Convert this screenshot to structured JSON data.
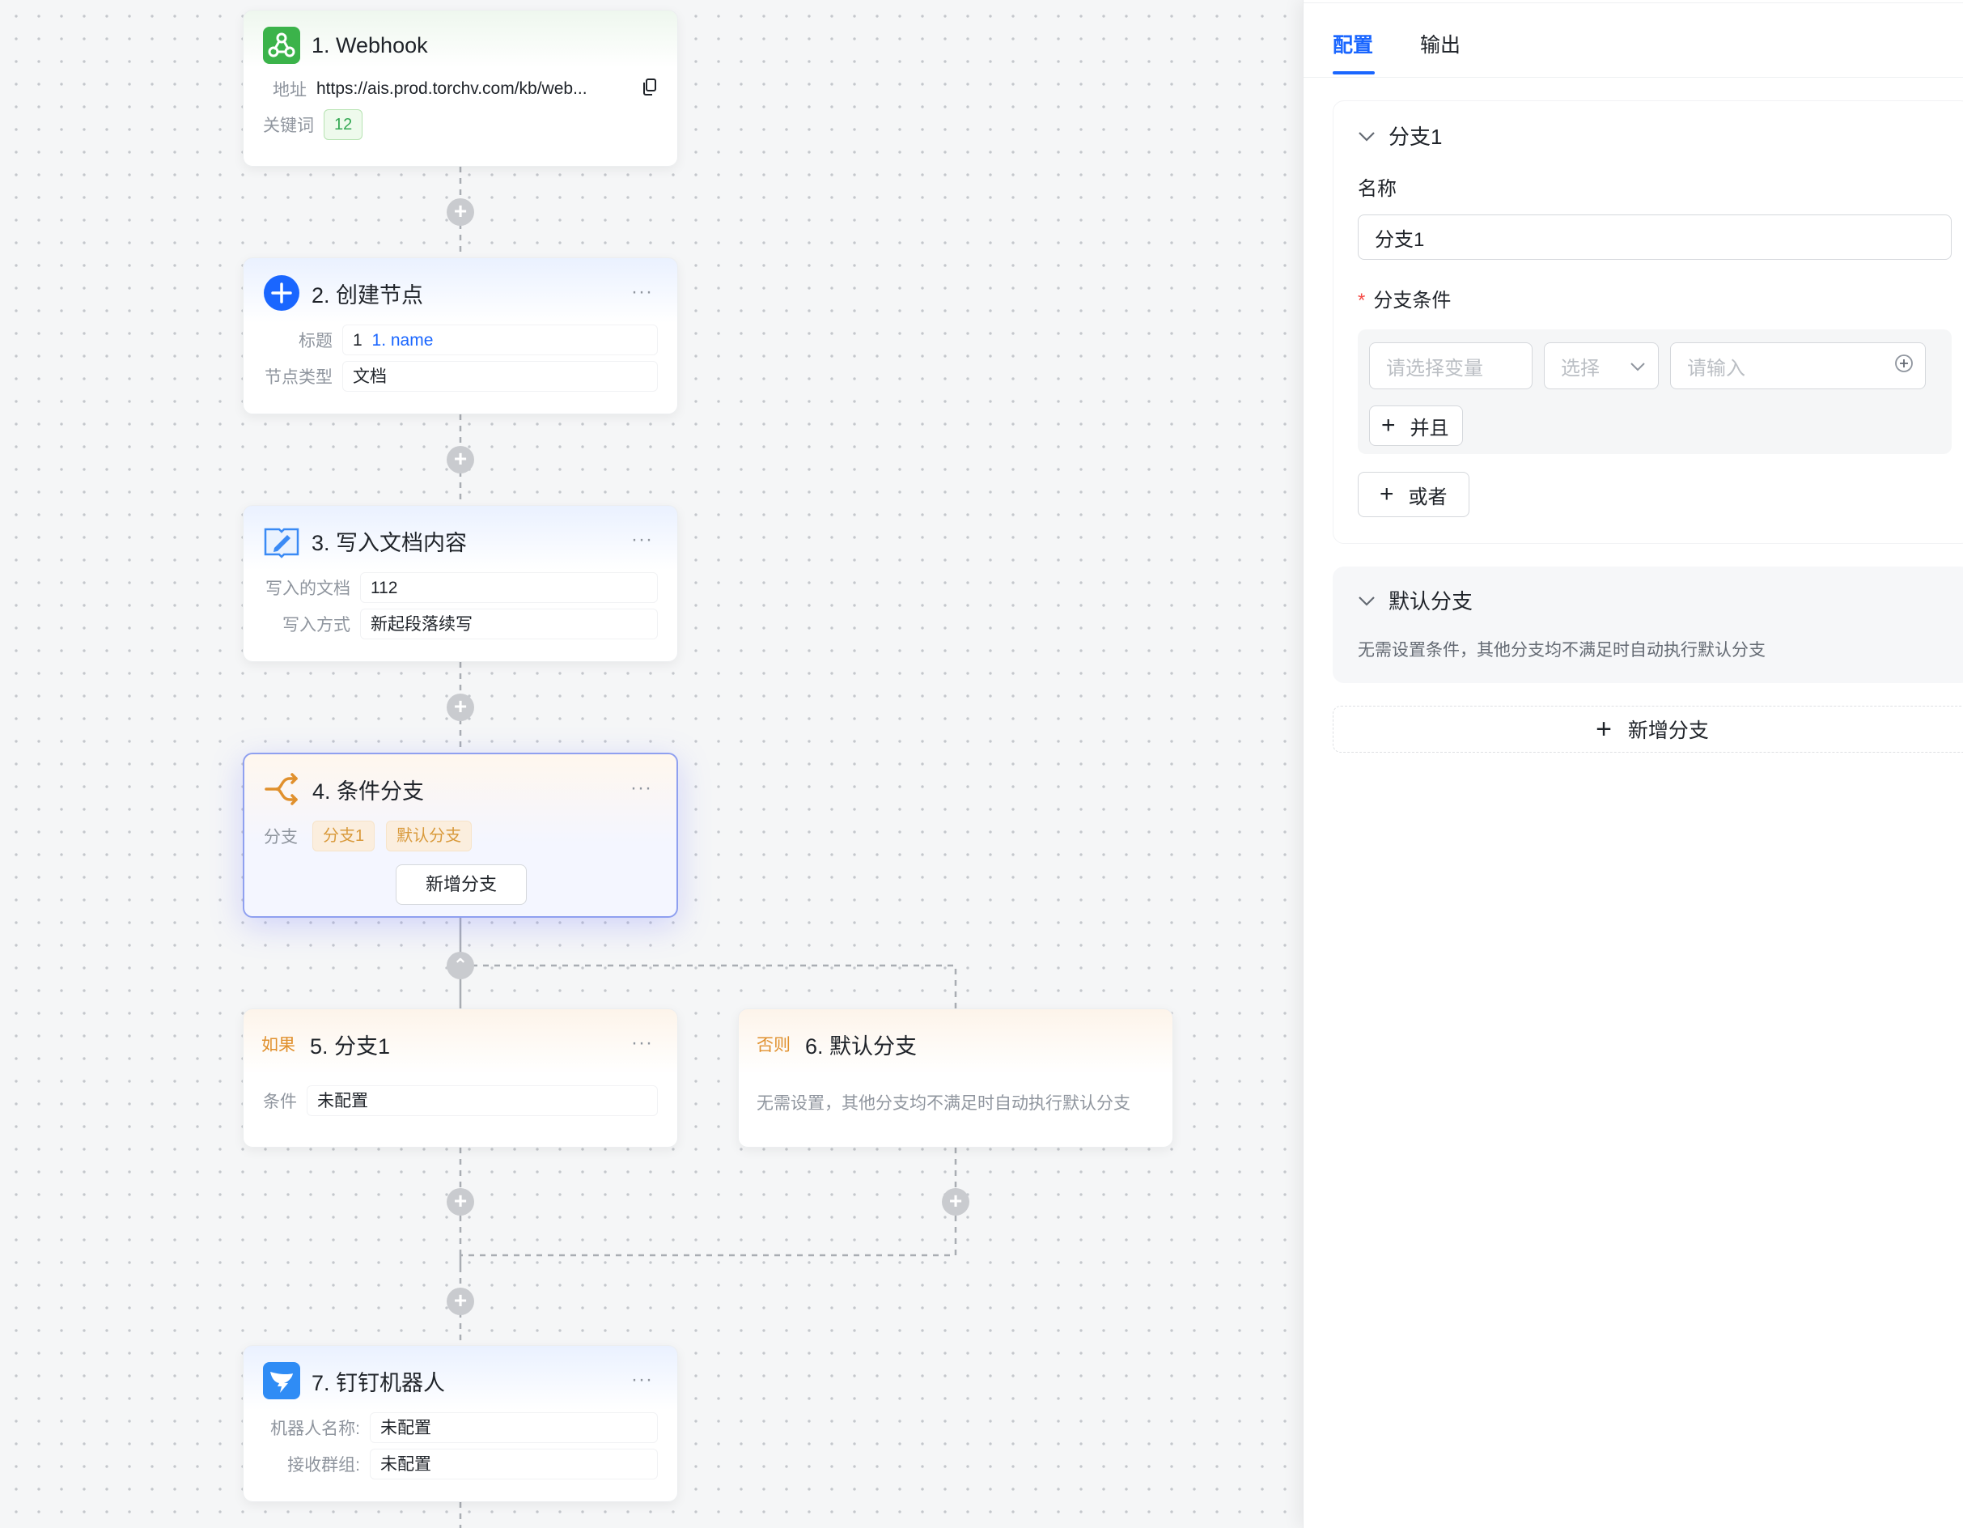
{
  "nodes": {
    "webhook": {
      "title": "1. Webhook",
      "address_label": "地址",
      "address_value": "https://ais.prod.torchv.com/kb/web...",
      "keyword_label": "关键词",
      "keyword_value": "12"
    },
    "create_node": {
      "title": "2. 创建节点",
      "more": "···",
      "title_label": "标题",
      "title_value_prefix": "1",
      "title_value_ref": "1. name",
      "type_label": "节点类型",
      "type_value": "文档"
    },
    "write_doc": {
      "title": "3. 写入文档内容",
      "more": "···",
      "doc_label": "写入的文档",
      "doc_value": "112",
      "mode_label": "写入方式",
      "mode_value": "新起段落续写"
    },
    "condition": {
      "title": "4. 条件分支",
      "more": "···",
      "branch_label": "分支",
      "branch_tags": [
        "分支1",
        "默认分支"
      ],
      "add_branch": "新增分支"
    },
    "branch1": {
      "prefix": "如果",
      "title": "5. 分支1",
      "more": "···",
      "cond_label": "条件",
      "cond_value": "未配置"
    },
    "default_branch": {
      "prefix": "否则",
      "title": "6. 默认分支",
      "desc": "无需设置，其他分支均不满足时自动执行默认分支"
    },
    "dingtalk": {
      "title": "7. 钉钉机器人",
      "more": "···",
      "robot_label": "机器人名称:",
      "robot_value": "未配置",
      "group_label": "接收群组:",
      "group_value": "未配置"
    }
  },
  "panel": {
    "tabs": [
      "配置",
      "输出"
    ],
    "active_tab": "配置",
    "branch1": {
      "header": "分支1",
      "name_label": "名称",
      "name_value": "分支1",
      "cond_label": "分支条件",
      "var_placeholder": "请选择变量",
      "op_placeholder": "选择",
      "value_placeholder": "请输入",
      "and_button": "并且",
      "or_button": "或者"
    },
    "default": {
      "header": "默认分支",
      "desc": "无需设置条件，其他分支均不满足时自动执行默认分支"
    },
    "add_branch": "新增分支"
  },
  "colors": {
    "accent": "#1a66ff",
    "webhook_icon": "#3bb34a",
    "condition_icon": "#e0902d",
    "dingtalk_icon": "#2f8cf5"
  }
}
